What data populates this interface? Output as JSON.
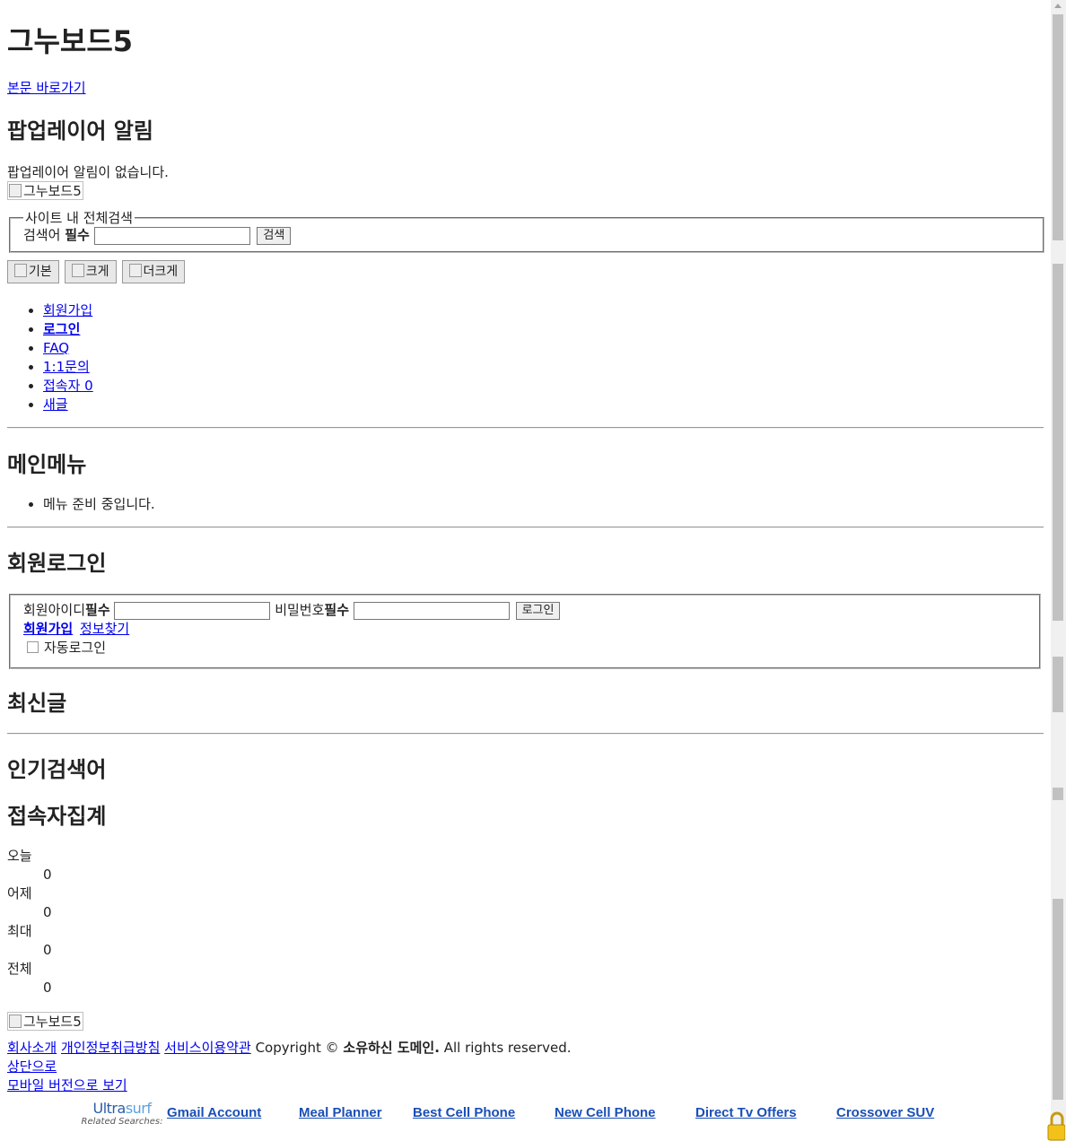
{
  "site": {
    "title": "그누보드5",
    "skip_link": "본문 바로가기",
    "logo_alt": "그누보드5"
  },
  "popup": {
    "heading": "팝업레이어 알림",
    "empty_text": "팝업레이어 알림이 없습니다."
  },
  "search": {
    "legend": "사이트 내 전체검색",
    "label": "검색어",
    "required": "필수",
    "input_value": "",
    "button": "검색"
  },
  "font_buttons": [
    "기본",
    "크게",
    "더크게"
  ],
  "top_links": [
    "회원가입",
    "로그인",
    "FAQ",
    "1:1문의",
    "접속자 0",
    "새글"
  ],
  "main_menu": {
    "heading": "메인메뉴",
    "items": [
      "메뉴 준비 중입니다."
    ]
  },
  "login": {
    "heading": "회원로그인",
    "id_label": "회원아이디",
    "pw_label": "비밀번호",
    "required": "필수",
    "id_value": "",
    "pw_value": "",
    "button": "로그인",
    "join_link": "회원가입",
    "find_link": "정보찾기",
    "auto_login": "자동로그인",
    "auto_login_checked": false
  },
  "latest": {
    "heading": "최신글"
  },
  "popular": {
    "heading": "인기검색어"
  },
  "visitors": {
    "heading": "접속자집계",
    "rows": [
      {
        "label": "오늘",
        "value": "0"
      },
      {
        "label": "어제",
        "value": "0"
      },
      {
        "label": "최대",
        "value": "0"
      },
      {
        "label": "전체",
        "value": "0"
      }
    ]
  },
  "footer": {
    "logo_alt": "그누보드5",
    "links": [
      "회사소개",
      "개인정보취급방침",
      "서비스이용약관"
    ],
    "copyright_prefix": "Copyright © ",
    "copyright_owner": "소유하신 도메인.",
    "copyright_suffix": " All rights reserved.",
    "to_top": "상단으로",
    "mobile": "모바일 버전으로 보기"
  },
  "related": {
    "brand_a": "Ultra",
    "brand_b": "surf",
    "caption": "Related Searches:",
    "links": [
      "Gmail Account",
      "Meal Planner",
      "Best Cell Phone",
      "New Cell Phone",
      "Direct Tv Offers",
      "Crossover SUV"
    ]
  },
  "colors": {
    "link": "#0000ee",
    "related_link": "#1a4fb5",
    "brand": "#2a5ea8"
  }
}
